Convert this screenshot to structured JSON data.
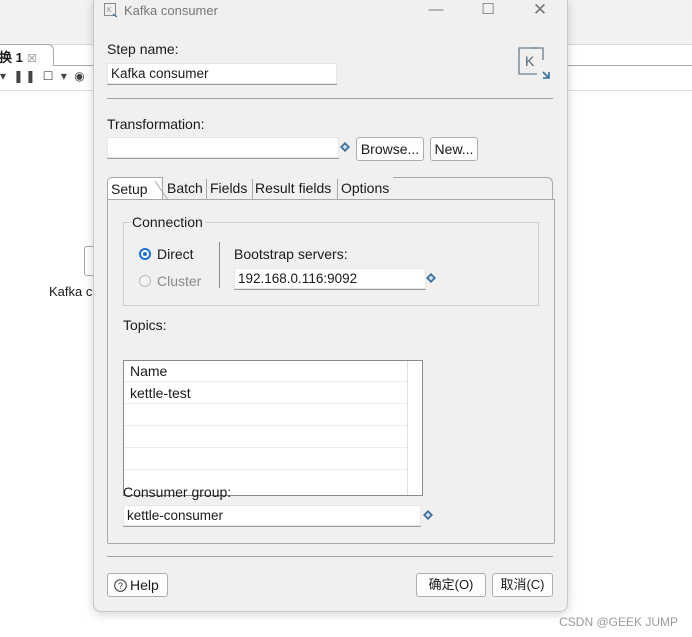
{
  "background": {
    "tab_label": "换 1",
    "tab_close": "☒",
    "toolbar_glyphs": "▾ ❚❚ ☐ ▾ ◉",
    "step_label": "Kafka c"
  },
  "watermark": "CSDN @GEEK JUMP",
  "dialog": {
    "title": "Kafka consumer",
    "step_name_label": "Step name:",
    "step_name_value": "Kafka consumer",
    "transformation_label": "Transformation:",
    "transformation_value": "",
    "browse_label": "Browse...",
    "new_label": "New...",
    "tabs": [
      {
        "label": "Setup",
        "active": true
      },
      {
        "label": "Batch",
        "active": false
      },
      {
        "label": "Fields",
        "active": false
      },
      {
        "label": "Result fields",
        "active": false
      },
      {
        "label": "Options",
        "active": false
      }
    ],
    "connection": {
      "group_title": "Connection",
      "direct_label": "Direct",
      "cluster_label": "Cluster",
      "selected": "Direct",
      "bootstrap_label": "Bootstrap servers:",
      "bootstrap_value": "192.168.0.116:9092"
    },
    "topics": {
      "label": "Topics:",
      "column_header": "Name",
      "rows": [
        "kettle-test",
        "",
        "",
        "",
        ""
      ]
    },
    "consumer_group_label": "Consumer group:",
    "consumer_group_value": "kettle-consumer",
    "help_label": "Help",
    "ok_label": "确定(O)",
    "cancel_label": "取消(C)"
  },
  "colors": {
    "accent": "#1a6fd6",
    "dialog_bg": "#f0f0f0",
    "variable_icon": "#3d6f99"
  },
  "icons": {
    "title": "kettle-window-icon",
    "step": "kafka-k-icon",
    "variable": "variable-diamond-icon",
    "help": "question-circle-icon"
  }
}
